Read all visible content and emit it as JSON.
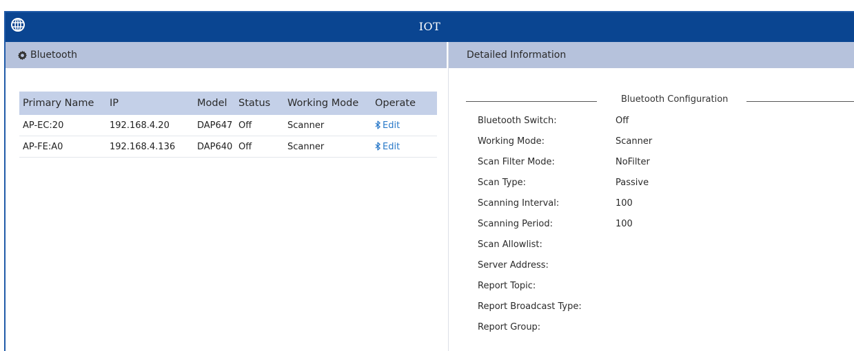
{
  "app": {
    "title": "IOT"
  },
  "bluetooth_panel": {
    "header": "Bluetooth",
    "columns": [
      "Primary Name",
      "IP",
      "Model",
      "Status",
      "Working Mode",
      "Operate"
    ],
    "rows": [
      {
        "name": "AP-EC:20",
        "ip": "192.168.4.20",
        "model": "DAP647",
        "status": "Off",
        "mode": "Scanner",
        "operate": "Edit"
      },
      {
        "name": "AP-FE:A0",
        "ip": "192.168.4.136",
        "model": "DAP640",
        "status": "Off",
        "mode": "Scanner",
        "operate": "Edit"
      }
    ]
  },
  "detail_panel": {
    "header": "Detailed Information",
    "section_title": "Bluetooth Configuration",
    "fields": [
      {
        "label": "Bluetooth Switch:",
        "value": "Off"
      },
      {
        "label": "Working Mode:",
        "value": "Scanner"
      },
      {
        "label": "Scan Filter Mode:",
        "value": "NoFilter"
      },
      {
        "label": "Scan Type:",
        "value": "Passive"
      },
      {
        "label": "Scanning Interval:",
        "value": "100"
      },
      {
        "label": "Scanning Period:",
        "value": "100"
      },
      {
        "label": "Scan Allowlist:",
        "value": ""
      },
      {
        "label": "Server Address:",
        "value": ""
      },
      {
        "label": "Report Topic:",
        "value": ""
      },
      {
        "label": "Report Broadcast Type:",
        "value": ""
      },
      {
        "label": "Report Group:",
        "value": ""
      }
    ]
  },
  "icons": {
    "title": "globe-icon",
    "panel": "gear-icon",
    "edit": "bluetooth-icon"
  },
  "colors": {
    "titlebar": "#0a4591",
    "panel_header": "#b6c2dc",
    "table_header": "#c4d0e8",
    "link": "#2878c8"
  }
}
